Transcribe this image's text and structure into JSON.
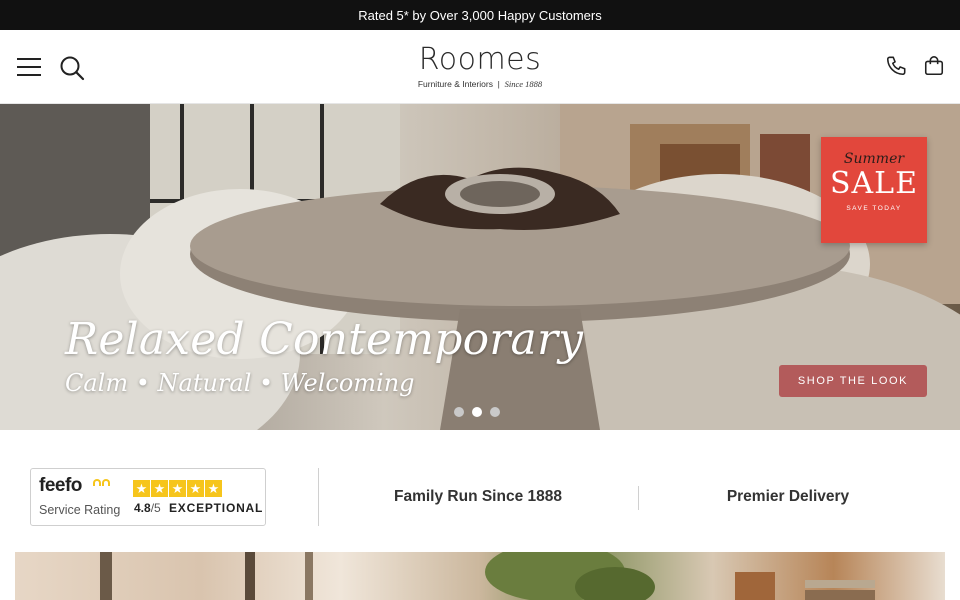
{
  "announcement": {
    "text": "Rated 5* by Over 3,000 Happy Customers"
  },
  "header": {
    "logo_name": "Roomes",
    "logo_tagline": "Furniture & Interiors",
    "logo_since": "Since 1888",
    "icons": {
      "menu": "hamburger-menu-icon",
      "search": "search-icon",
      "phone": "phone-icon",
      "bag": "shopping-bag-icon"
    }
  },
  "hero": {
    "title": "Relaxed Contemporary",
    "subtitle": "Calm • Natural • Welcoming",
    "cta_label": "SHOP THE LOOK",
    "cta_color": "#b35b5b",
    "sale_badge": {
      "script": "Summer",
      "big": "SALE",
      "small": "SAVE TODAY",
      "color": "#e2473c"
    },
    "slides": {
      "count": 3,
      "active_index": 1
    }
  },
  "trust_bar": {
    "feefo": {
      "brand": "feefo",
      "label": "Service Rating",
      "rating": "4.8",
      "rating_max": "/5",
      "rating_word": "EXCEPTIONAL",
      "stars": 5,
      "star_color": "#f6c51c"
    },
    "items": [
      "Family Run Since 1888",
      "Premier Delivery"
    ]
  }
}
